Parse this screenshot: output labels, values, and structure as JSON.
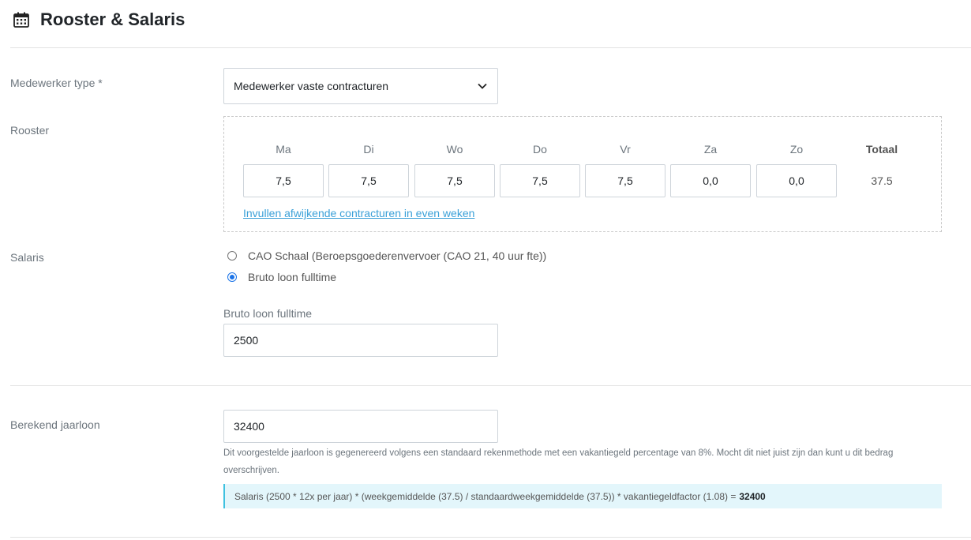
{
  "header": {
    "title": "Rooster & Salaris",
    "icon": "calendar-icon"
  },
  "employee_type": {
    "label": "Medewerker type *",
    "selected": "Medewerker vaste contracturen"
  },
  "rooster": {
    "label": "Rooster",
    "days": [
      {
        "name": "Ma",
        "value": "7,5"
      },
      {
        "name": "Di",
        "value": "7,5"
      },
      {
        "name": "Wo",
        "value": "7,5"
      },
      {
        "name": "Do",
        "value": "7,5"
      },
      {
        "name": "Vr",
        "value": "7,5"
      },
      {
        "name": "Za",
        "value": "0,0"
      },
      {
        "name": "Zo",
        "value": "0,0"
      }
    ],
    "total_label": "Totaal",
    "total_value": "37.5",
    "link": "Invullen afwijkende contracturen in even weken"
  },
  "salaris": {
    "label": "Salaris",
    "options": [
      {
        "label": "CAO Schaal (Beroepsgoederenvervoer (CAO 21, 40 uur fte))",
        "checked": false
      },
      {
        "label": "Bruto loon fulltime",
        "checked": true
      }
    ],
    "field_label": "Bruto loon fulltime",
    "field_value": "2500"
  },
  "jaarloon": {
    "label": "Berekend jaarloon",
    "value": "32400",
    "help": "Dit voorgestelde jaarloon is gegenereerd volgens een standaard rekenmethode met een vakantiegeld percentage van 8%. Mocht dit niet juist zijn dan kunt u dit bedrag overschrijven.",
    "formula_text": "Salaris (2500 * 12x per jaar) * (weekgemiddelde (37.5) / standaardweekgemiddelde (37.5)) * vakantiegeldfactor (1.08) =",
    "formula_result": "32400"
  },
  "colors": {
    "accent": "#1a73e8",
    "link": "#3aa0d8",
    "info_bg": "#e3f6fb",
    "info_border": "#3ec1e0"
  }
}
